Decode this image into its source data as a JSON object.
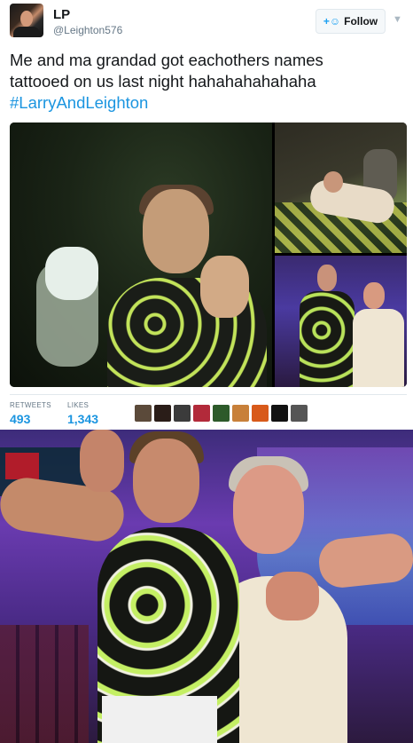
{
  "tweet": {
    "author": {
      "display_name": "LP",
      "handle": "@Leighton576",
      "avatar_icon": "user-avatar"
    },
    "follow_button": {
      "label": "Follow",
      "icon": "add-user-icon"
    },
    "more_icon": "chevron-down-icon",
    "text": {
      "line1": "Me and ma grandad got eachothers names",
      "line2": "tattooed on us last night hahahahahahaha",
      "hashtag": "#LarryAndLeighton"
    },
    "media": [
      {
        "label": "tattoo session photo"
      },
      {
        "label": "man lying on floor photo"
      },
      {
        "label": "grandson and grandad photo"
      }
    ],
    "stats": {
      "retweets_label": "RETWEETS",
      "retweets_value": "493",
      "likes_label": "LIKES",
      "likes_value": "1,343"
    },
    "likers": [
      {
        "color": "#5b4a3a"
      },
      {
        "color": "#2a1d18"
      },
      {
        "color": "#3b3b3b"
      },
      {
        "color": "#b22a3a"
      },
      {
        "color": "#2d5a2a"
      },
      {
        "color": "#c8803a"
      },
      {
        "color": "#d85a1a"
      },
      {
        "color": "#111111"
      },
      {
        "color": "#555555"
      }
    ]
  },
  "colors": {
    "link": "#1b95e0",
    "secondary_text": "#657786",
    "follow_accent": "#1da1f2"
  }
}
